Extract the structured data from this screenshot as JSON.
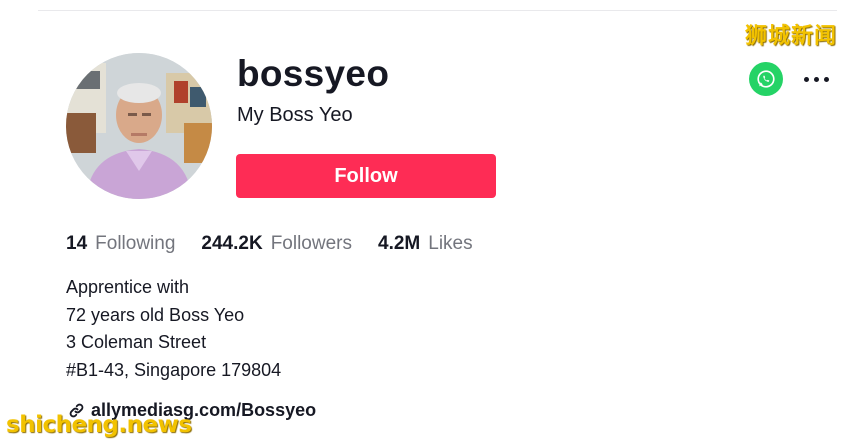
{
  "profile": {
    "username": "bossyeo",
    "nickname": "My Boss Yeo",
    "follow_label": "Follow",
    "stats": [
      {
        "value": "14",
        "label": "Following"
      },
      {
        "value": "244.2K",
        "label": "Followers"
      },
      {
        "value": "4.2M",
        "label": "Likes"
      }
    ],
    "bio_lines": [
      "Apprentice with",
      "72 years old Boss Yeo",
      "3 Coleman Street",
      "#B1-43, Singapore 179804"
    ],
    "link_text": "allymediasg.com/Bossyeo"
  },
  "actions": {
    "share_icon": "whatsapp-icon",
    "more_icon": "more-options-icon"
  },
  "watermarks": {
    "top_right": "狮城新闻",
    "bottom_left": "shicheng.news"
  },
  "colors": {
    "accent": "#fe2c55",
    "whatsapp": "#25d366",
    "text_primary": "#161823",
    "text_secondary": "#73757d",
    "watermark": "#f2c200"
  }
}
